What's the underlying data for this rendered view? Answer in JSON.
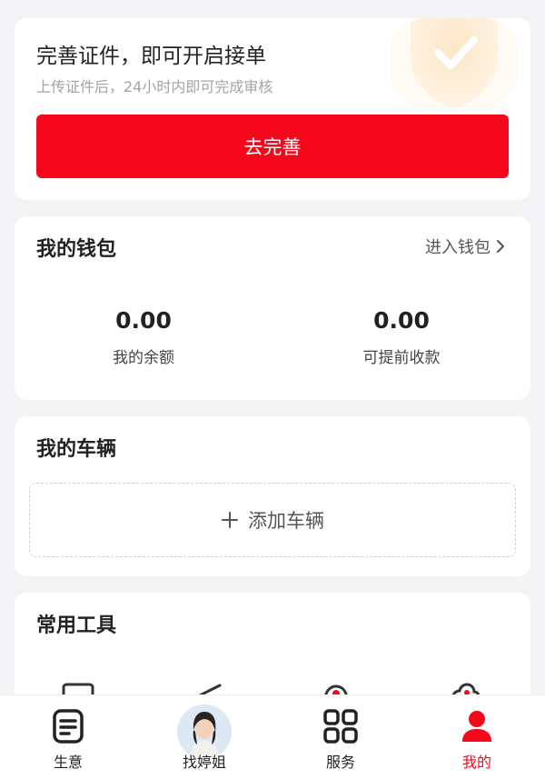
{
  "cert": {
    "title": "完善证件，即可开启接单",
    "subtitle": "上传证件后，24小时内即可完成审核",
    "button_label": "去完善"
  },
  "wallet": {
    "title": "我的钱包",
    "link_label": "进入钱包",
    "balance_value": "0.00",
    "balance_label": "我的余额",
    "withdraw_value": "0.00",
    "withdraw_label": "可提前收款"
  },
  "vehicles": {
    "title": "我的车辆",
    "add_label": "添加车辆"
  },
  "tools": {
    "title": "常用工具"
  },
  "nav": {
    "items": [
      {
        "label": "生意",
        "icon": "document-icon"
      },
      {
        "label": "找婷姐",
        "icon": "avatar"
      },
      {
        "label": "服务",
        "icon": "grid-icon"
      },
      {
        "label": "我的",
        "icon": "user-icon"
      }
    ],
    "active_index": 3
  },
  "colors": {
    "accent": "#f5071c",
    "background": "#f4f4f6",
    "card": "#ffffff"
  }
}
